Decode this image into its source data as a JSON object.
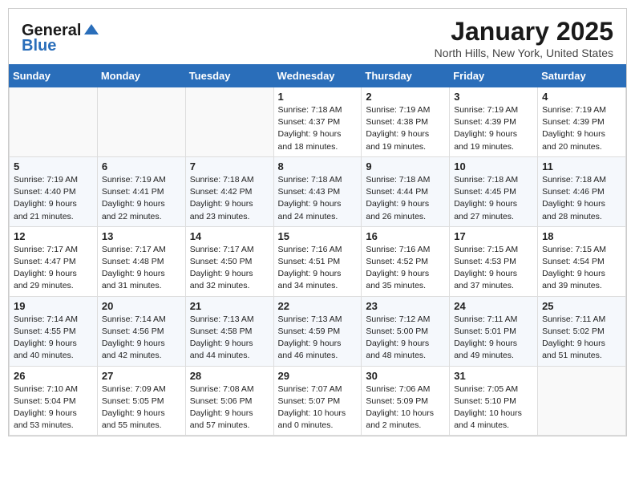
{
  "header": {
    "logo_general": "General",
    "logo_blue": "Blue",
    "month": "January 2025",
    "location": "North Hills, New York, United States"
  },
  "days_of_week": [
    "Sunday",
    "Monday",
    "Tuesday",
    "Wednesday",
    "Thursday",
    "Friday",
    "Saturday"
  ],
  "weeks": [
    [
      {
        "day": "",
        "info": ""
      },
      {
        "day": "",
        "info": ""
      },
      {
        "day": "",
        "info": ""
      },
      {
        "day": "1",
        "info": "Sunrise: 7:18 AM\nSunset: 4:37 PM\nDaylight: 9 hours\nand 18 minutes."
      },
      {
        "day": "2",
        "info": "Sunrise: 7:19 AM\nSunset: 4:38 PM\nDaylight: 9 hours\nand 19 minutes."
      },
      {
        "day": "3",
        "info": "Sunrise: 7:19 AM\nSunset: 4:39 PM\nDaylight: 9 hours\nand 19 minutes."
      },
      {
        "day": "4",
        "info": "Sunrise: 7:19 AM\nSunset: 4:39 PM\nDaylight: 9 hours\nand 20 minutes."
      }
    ],
    [
      {
        "day": "5",
        "info": "Sunrise: 7:19 AM\nSunset: 4:40 PM\nDaylight: 9 hours\nand 21 minutes."
      },
      {
        "day": "6",
        "info": "Sunrise: 7:19 AM\nSunset: 4:41 PM\nDaylight: 9 hours\nand 22 minutes."
      },
      {
        "day": "7",
        "info": "Sunrise: 7:18 AM\nSunset: 4:42 PM\nDaylight: 9 hours\nand 23 minutes."
      },
      {
        "day": "8",
        "info": "Sunrise: 7:18 AM\nSunset: 4:43 PM\nDaylight: 9 hours\nand 24 minutes."
      },
      {
        "day": "9",
        "info": "Sunrise: 7:18 AM\nSunset: 4:44 PM\nDaylight: 9 hours\nand 26 minutes."
      },
      {
        "day": "10",
        "info": "Sunrise: 7:18 AM\nSunset: 4:45 PM\nDaylight: 9 hours\nand 27 minutes."
      },
      {
        "day": "11",
        "info": "Sunrise: 7:18 AM\nSunset: 4:46 PM\nDaylight: 9 hours\nand 28 minutes."
      }
    ],
    [
      {
        "day": "12",
        "info": "Sunrise: 7:17 AM\nSunset: 4:47 PM\nDaylight: 9 hours\nand 29 minutes."
      },
      {
        "day": "13",
        "info": "Sunrise: 7:17 AM\nSunset: 4:48 PM\nDaylight: 9 hours\nand 31 minutes."
      },
      {
        "day": "14",
        "info": "Sunrise: 7:17 AM\nSunset: 4:50 PM\nDaylight: 9 hours\nand 32 minutes."
      },
      {
        "day": "15",
        "info": "Sunrise: 7:16 AM\nSunset: 4:51 PM\nDaylight: 9 hours\nand 34 minutes."
      },
      {
        "day": "16",
        "info": "Sunrise: 7:16 AM\nSunset: 4:52 PM\nDaylight: 9 hours\nand 35 minutes."
      },
      {
        "day": "17",
        "info": "Sunrise: 7:15 AM\nSunset: 4:53 PM\nDaylight: 9 hours\nand 37 minutes."
      },
      {
        "day": "18",
        "info": "Sunrise: 7:15 AM\nSunset: 4:54 PM\nDaylight: 9 hours\nand 39 minutes."
      }
    ],
    [
      {
        "day": "19",
        "info": "Sunrise: 7:14 AM\nSunset: 4:55 PM\nDaylight: 9 hours\nand 40 minutes."
      },
      {
        "day": "20",
        "info": "Sunrise: 7:14 AM\nSunset: 4:56 PM\nDaylight: 9 hours\nand 42 minutes."
      },
      {
        "day": "21",
        "info": "Sunrise: 7:13 AM\nSunset: 4:58 PM\nDaylight: 9 hours\nand 44 minutes."
      },
      {
        "day": "22",
        "info": "Sunrise: 7:13 AM\nSunset: 4:59 PM\nDaylight: 9 hours\nand 46 minutes."
      },
      {
        "day": "23",
        "info": "Sunrise: 7:12 AM\nSunset: 5:00 PM\nDaylight: 9 hours\nand 48 minutes."
      },
      {
        "day": "24",
        "info": "Sunrise: 7:11 AM\nSunset: 5:01 PM\nDaylight: 9 hours\nand 49 minutes."
      },
      {
        "day": "25",
        "info": "Sunrise: 7:11 AM\nSunset: 5:02 PM\nDaylight: 9 hours\nand 51 minutes."
      }
    ],
    [
      {
        "day": "26",
        "info": "Sunrise: 7:10 AM\nSunset: 5:04 PM\nDaylight: 9 hours\nand 53 minutes."
      },
      {
        "day": "27",
        "info": "Sunrise: 7:09 AM\nSunset: 5:05 PM\nDaylight: 9 hours\nand 55 minutes."
      },
      {
        "day": "28",
        "info": "Sunrise: 7:08 AM\nSunset: 5:06 PM\nDaylight: 9 hours\nand 57 minutes."
      },
      {
        "day": "29",
        "info": "Sunrise: 7:07 AM\nSunset: 5:07 PM\nDaylight: 10 hours\nand 0 minutes."
      },
      {
        "day": "30",
        "info": "Sunrise: 7:06 AM\nSunset: 5:09 PM\nDaylight: 10 hours\nand 2 minutes."
      },
      {
        "day": "31",
        "info": "Sunrise: 7:05 AM\nSunset: 5:10 PM\nDaylight: 10 hours\nand 4 minutes."
      },
      {
        "day": "",
        "info": ""
      }
    ]
  ]
}
